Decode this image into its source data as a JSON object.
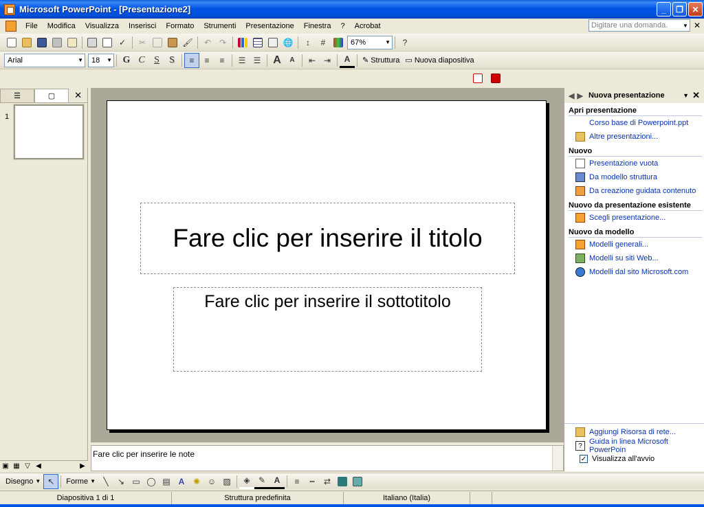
{
  "window": {
    "title": "Microsoft PowerPoint - [Presentazione2]"
  },
  "menu": [
    "File",
    "Modifica",
    "Visualizza",
    "Inserisci",
    "Formato",
    "Strumenti",
    "Presentazione",
    "Finestra",
    "?",
    "Acrobat"
  ],
  "ask_box": {
    "placeholder": "Digitare una domanda."
  },
  "standard_toolbar": {
    "zoom": "67%"
  },
  "format_toolbar": {
    "font": "Arial",
    "size": "18",
    "bold": "G",
    "italic": "C",
    "underline": "S",
    "shadow": "S",
    "structure": "Struttura",
    "new_slide": "Nuova diapositiva"
  },
  "slide_pane": {
    "slide_number": "1"
  },
  "slide": {
    "title_placeholder": "Fare clic per inserire il titolo",
    "subtitle_placeholder": "Fare clic per inserire il sottotitolo"
  },
  "notes": {
    "placeholder": "Fare clic per inserire le note"
  },
  "task_pane": {
    "title": "Nuova presentazione",
    "sections": [
      {
        "heading": "Apri presentazione",
        "items": [
          {
            "label": "Corso base di Powerpoint.ppt",
            "icon": "none"
          },
          {
            "label": "Altre presentazioni...",
            "icon": "folder-open-icon"
          }
        ]
      },
      {
        "heading": "Nuovo",
        "items": [
          {
            "label": "Presentazione vuota",
            "icon": "blank-doc-icon"
          },
          {
            "label": "Da modello struttura",
            "icon": "design-template-icon"
          },
          {
            "label": "Da creazione guidata contenuto",
            "icon": "wizard-icon"
          }
        ]
      },
      {
        "heading": "Nuovo da presentazione esistente",
        "items": [
          {
            "label": "Scegli presentazione...",
            "icon": "presentation-icon"
          }
        ]
      },
      {
        "heading": "Nuovo da modello",
        "items": [
          {
            "label": "Modelli generali...",
            "icon": "templates-icon"
          },
          {
            "label": "Modelli su siti Web...",
            "icon": "web-templates-icon"
          },
          {
            "label": "Modelli dal sito Microsoft.com",
            "icon": "globe-icon"
          }
        ]
      }
    ],
    "bottom": {
      "add_network": "Aggiungi Risorsa di rete...",
      "help": "Guida in linea Microsoft PowerPoin",
      "show_startup": "Visualizza all'avvio"
    }
  },
  "drawing_toolbar": {
    "draw": "Disegno",
    "shapes": "Forme"
  },
  "status": {
    "slide": "Diapositiva 1 di 1",
    "design": "Struttura predefinita",
    "language": "Italiano (Italia)"
  },
  "colors": {
    "titlebar": "#0054e3",
    "link": "#0a33b0",
    "slide_bg": "#aca899"
  }
}
